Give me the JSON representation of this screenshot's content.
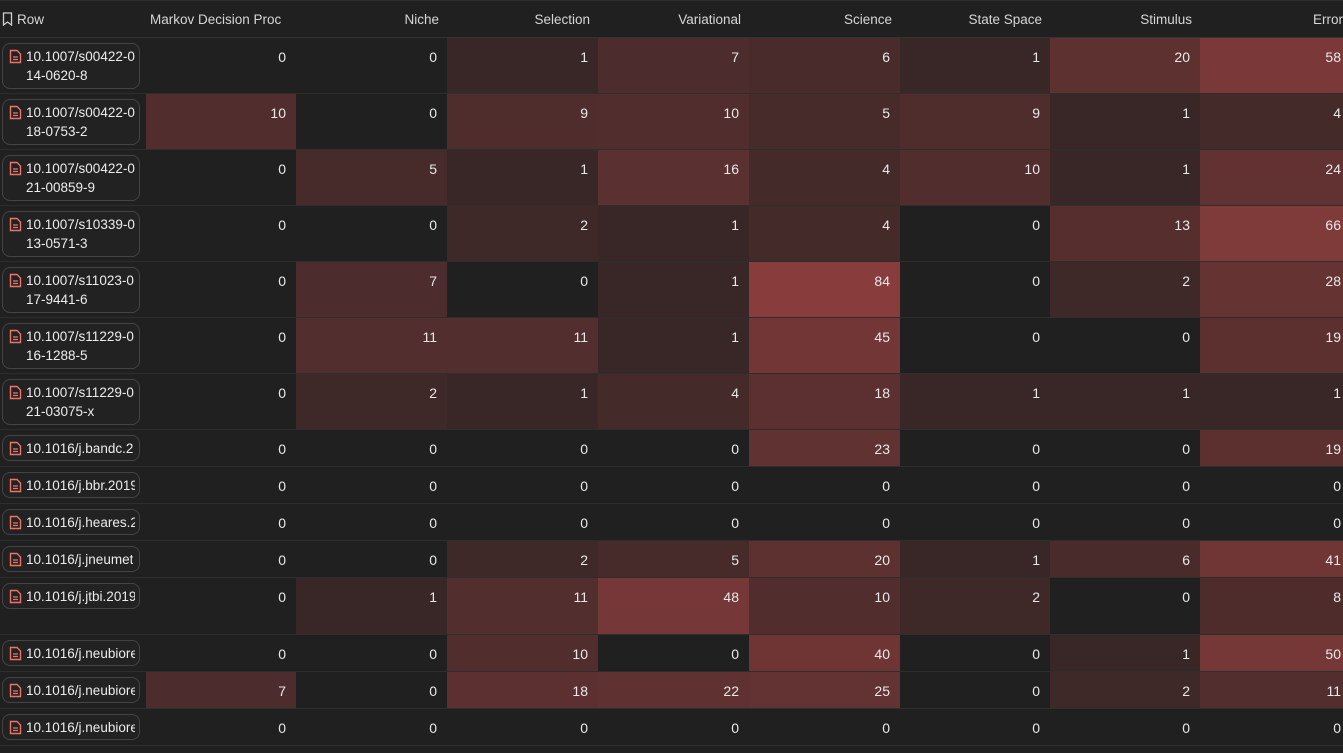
{
  "table": {
    "columns": [
      "Row",
      "Markov Decision Proc",
      "Niche",
      "Selection",
      "Variational",
      "Science",
      "State Space",
      "Stimulus",
      "Error"
    ],
    "max_value": 84,
    "rows": [
      {
        "id": "10.1007/s00422-014-0620-8",
        "wrap": true,
        "values": [
          0,
          0,
          1,
          7,
          6,
          1,
          20,
          58
        ]
      },
      {
        "id": "10.1007/s00422-018-0753-2",
        "wrap": true,
        "values": [
          10,
          0,
          9,
          10,
          5,
          9,
          1,
          4
        ]
      },
      {
        "id": "10.1007/s00422-021-00859-9",
        "wrap": true,
        "values": [
          0,
          5,
          1,
          16,
          4,
          10,
          1,
          24
        ]
      },
      {
        "id": "10.1007/s10339-013-0571-3",
        "wrap": true,
        "values": [
          0,
          0,
          2,
          1,
          4,
          0,
          13,
          66
        ]
      },
      {
        "id": "10.1007/s11023-017-9441-6",
        "wrap": true,
        "values": [
          0,
          7,
          0,
          1,
          84,
          0,
          2,
          28
        ]
      },
      {
        "id": "10.1007/s11229-016-1288-5",
        "wrap": true,
        "values": [
          0,
          11,
          11,
          1,
          45,
          0,
          0,
          19
        ]
      },
      {
        "id": "10.1007/s11229-021-03075-x",
        "wrap": true,
        "values": [
          0,
          2,
          1,
          4,
          18,
          1,
          1,
          1
        ]
      },
      {
        "id": "10.1016/j.bandc.2",
        "wrap": false,
        "values": [
          0,
          0,
          0,
          0,
          23,
          0,
          0,
          19
        ]
      },
      {
        "id": "10.1016/j.bbr.2019",
        "wrap": false,
        "values": [
          0,
          0,
          0,
          0,
          0,
          0,
          0,
          0
        ]
      },
      {
        "id": "10.1016/j.heares.2",
        "wrap": false,
        "values": [
          0,
          0,
          0,
          0,
          0,
          0,
          0,
          0
        ]
      },
      {
        "id": "10.1016/j.jneumet",
        "wrap": false,
        "values": [
          0,
          0,
          2,
          5,
          20,
          1,
          6,
          41
        ]
      },
      {
        "id": "10.1016/j.jtbi.2019",
        "wrap": false,
        "tall": true,
        "values": [
          0,
          1,
          11,
          48,
          10,
          2,
          0,
          8
        ]
      },
      {
        "id": "10.1016/j.neubiore",
        "wrap": false,
        "values": [
          0,
          0,
          10,
          0,
          40,
          0,
          1,
          50
        ]
      },
      {
        "id": "10.1016/j.neubiore",
        "wrap": false,
        "values": [
          7,
          0,
          18,
          22,
          25,
          0,
          2,
          11
        ]
      },
      {
        "id": "10.1016/j.neubiore",
        "wrap": false,
        "values": [
          0,
          0,
          0,
          0,
          0,
          0,
          0,
          0
        ]
      }
    ]
  },
  "colors": {
    "background": "#202020",
    "heat_max": "#883c3c",
    "text": "#e9e9e9",
    "doc_icon": "#e8746a"
  },
  "icons": {
    "header": "bookmark-icon",
    "row": "document-icon"
  }
}
